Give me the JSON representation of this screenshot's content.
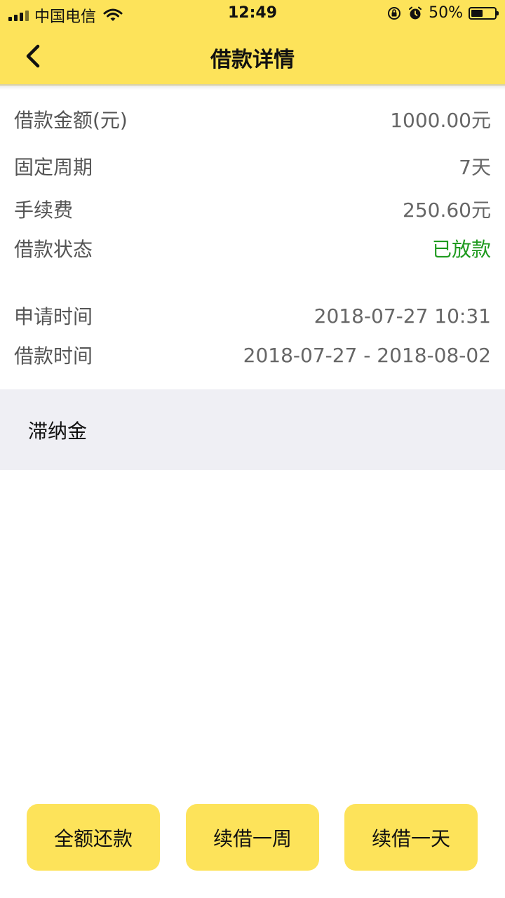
{
  "status_bar": {
    "carrier": "中国电信",
    "time": "12:49",
    "battery": "50%",
    "battery_level": 0.5,
    "icons": [
      "signal-icon",
      "wifi-icon",
      "orientation-lock-icon",
      "alarm-icon",
      "battery-icon"
    ]
  },
  "nav": {
    "title": "借款详情",
    "back_icon": "chevron-left-icon"
  },
  "details": [
    {
      "label": "借款金额(元)",
      "value": "1000.00元"
    },
    {
      "label": "固定周期",
      "value": "7天"
    },
    {
      "label": "手续费",
      "value": "250.60元"
    },
    {
      "label": "借款状态",
      "value": "已放款",
      "color": "#1e9a1e"
    },
    {
      "label": "申请时间",
      "value": "2018-07-27 10:31"
    },
    {
      "label": "借款时间",
      "value": "2018-07-27 - 2018-08-02"
    }
  ],
  "late_fee_section": {
    "title": "滞纳金"
  },
  "actions": [
    {
      "label": "全额还款"
    },
    {
      "label": "续借一周"
    },
    {
      "label": "续借一天"
    }
  ],
  "colors": {
    "accent": "#fde35a",
    "status_green": "#1e9a1e",
    "section_bg": "#efeff4"
  }
}
